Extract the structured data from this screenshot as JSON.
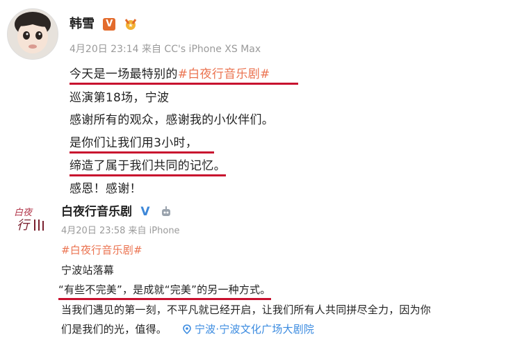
{
  "post1": {
    "author": "韩雪",
    "meta": "4月20日 23:14 来自 CC's iPhone XS Max",
    "line1_prefix": "今天是一场最特别的",
    "line1_hashtag": "#白夜行音乐剧#",
    "line2": "巡演第18场，宁波",
    "line3": "感谢所有的观众，感谢我的小伙伴们。",
    "line4": "是你们让我们用3小时，",
    "line5": "缔造了属于我们共同的记忆。",
    "line6": "感恩！感谢！"
  },
  "post2": {
    "author": "白夜行音乐剧",
    "logo_text_1": "白夜",
    "logo_text_2": "行",
    "meta": "4月20日 23:58 来自 iPhone",
    "hashtag": "#白夜行音乐剧#",
    "line1": "宁波站落幕",
    "line2": "“有些不完美”，是成就“完美”的另一种方式。",
    "line3": "当我们遇见的第一刻，不平凡就已经开启，让我们所有人共同拼尽全力，因为你",
    "line4_prefix": "们是我们的光，值得。",
    "location": "宁波·宁波文化广场大剧院"
  },
  "colors": {
    "underline": "#c8102e",
    "hashtag": "#eb7350",
    "link": "#3b8be0"
  },
  "icons": [
    "avatar",
    "orange-v-icon",
    "medal-icon",
    "blue-v-icon",
    "robot-icon",
    "location-pin-icon"
  ]
}
